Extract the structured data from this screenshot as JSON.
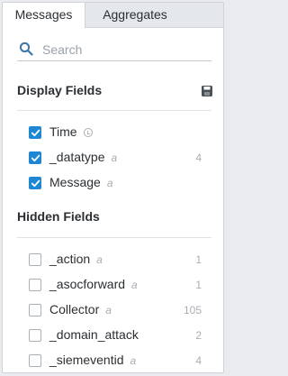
{
  "tabs": [
    {
      "label": "Messages",
      "active": true
    },
    {
      "label": "Aggregates",
      "active": false
    }
  ],
  "search": {
    "placeholder": "Search",
    "value": ""
  },
  "display_fields": {
    "title": "Display Fields",
    "icon": "save-icon",
    "items": [
      {
        "name": "Time",
        "type": "",
        "count": "",
        "checked": true,
        "icon": "clock-icon"
      },
      {
        "name": "_datatype",
        "type": "a",
        "count": "4",
        "checked": true
      },
      {
        "name": "Message",
        "type": "a",
        "count": "",
        "checked": true
      }
    ]
  },
  "hidden_fields": {
    "title": "Hidden Fields",
    "items": [
      {
        "name": "_action",
        "type": "a",
        "count": "1",
        "checked": false
      },
      {
        "name": "_asocforward",
        "type": "a",
        "count": "1",
        "checked": false
      },
      {
        "name": "Collector",
        "type": "a",
        "count": "105",
        "checked": false
      },
      {
        "name": "_domain_attack",
        "type": "",
        "count": "2",
        "checked": false
      },
      {
        "name": "_siemeventid",
        "type": "a",
        "count": "4",
        "checked": false
      }
    ]
  },
  "colors": {
    "accent": "#1f86d3",
    "text": "#2b2f33",
    "muted": "#a8aeb4"
  }
}
